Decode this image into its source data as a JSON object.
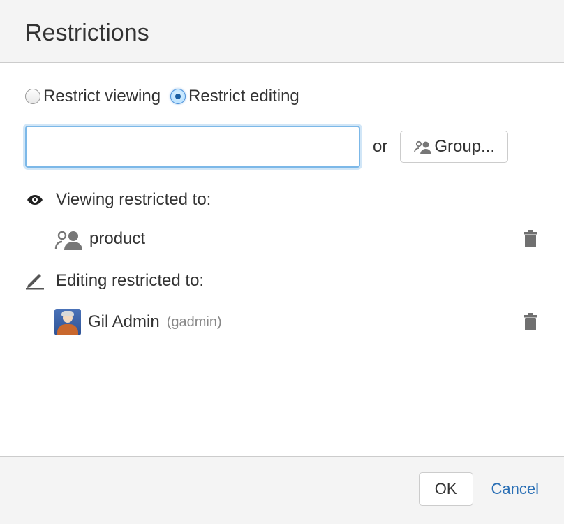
{
  "header": {
    "title": "Restrictions"
  },
  "radios": {
    "viewing": "Restrict viewing",
    "editing": "Restrict editing",
    "selected": "editing"
  },
  "input": {
    "or": "or",
    "group_button": "Group..."
  },
  "sections": {
    "viewing": {
      "title": "Viewing restricted to:",
      "entries": [
        {
          "type": "group",
          "name": "product"
        }
      ]
    },
    "editing": {
      "title": "Editing restricted to:",
      "entries": [
        {
          "type": "user",
          "name": "Gil Admin",
          "username": "(gadmin)"
        }
      ]
    }
  },
  "footer": {
    "ok": "OK",
    "cancel": "Cancel"
  }
}
